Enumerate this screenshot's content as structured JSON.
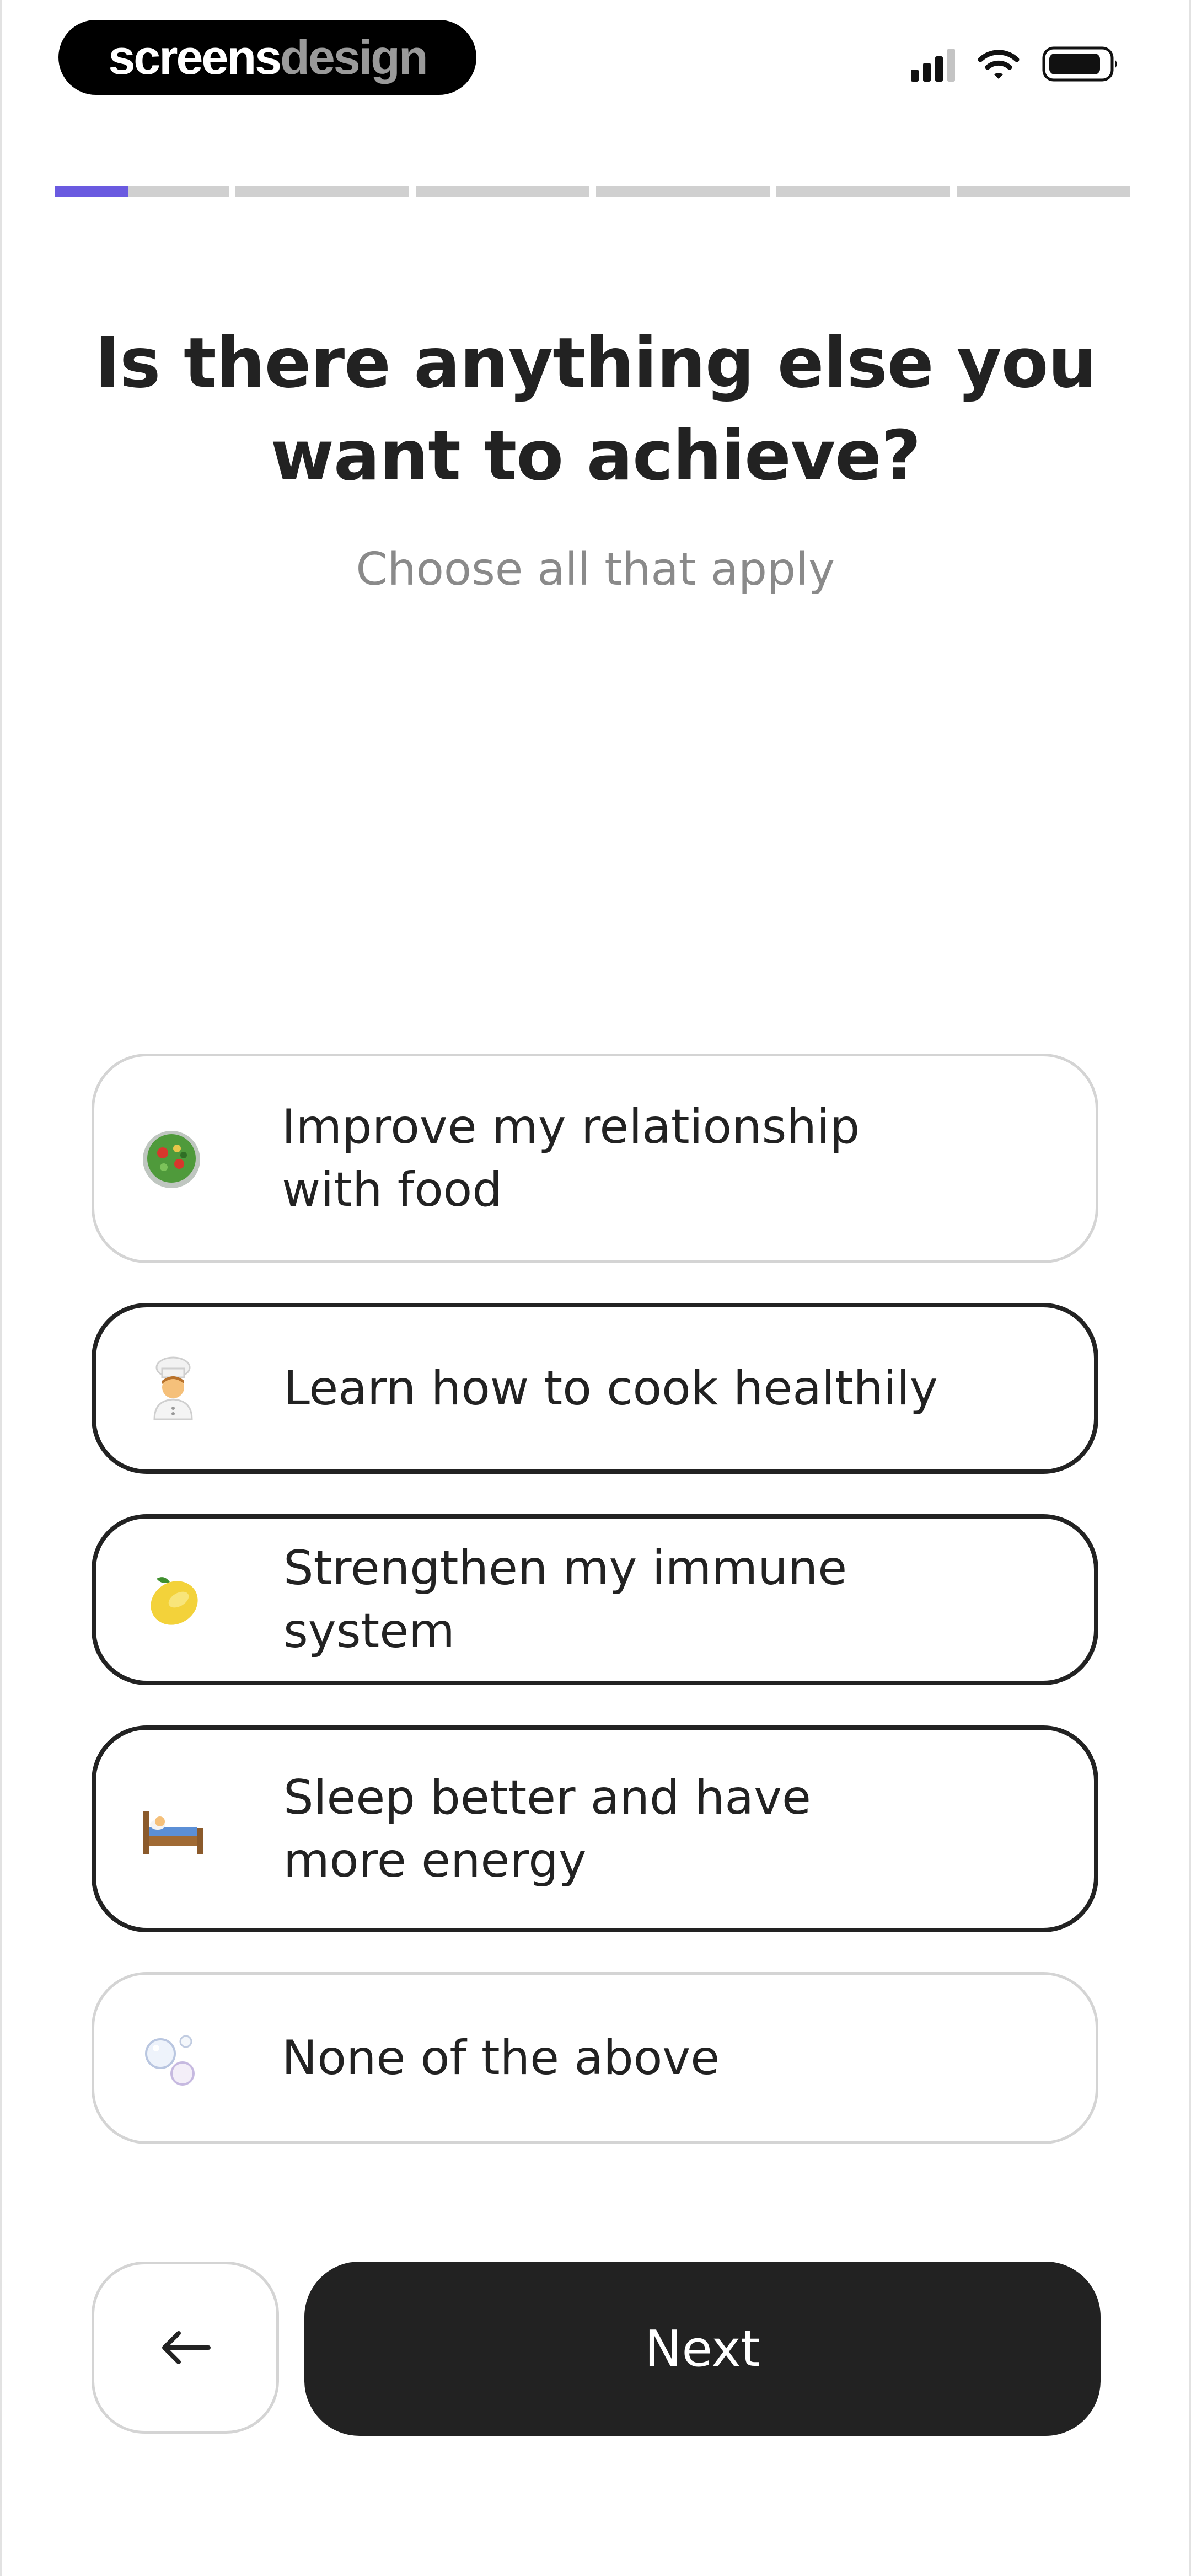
{
  "watermark": {
    "word1": "screens",
    "word2": "design"
  },
  "status_bar": {
    "icons": [
      "signal-icon",
      "wifi-icon",
      "battery-icon"
    ]
  },
  "progress": {
    "segments": 6,
    "current_step_fraction": 0.42
  },
  "question": {
    "title_line1": "Is there anything else you",
    "title_line2": "want to achieve?",
    "subtitle": "Choose all that apply"
  },
  "options": [
    {
      "line1": "Improve my relationship",
      "line2": "with food",
      "icon": "salad-icon",
      "selected": false
    },
    {
      "line1": "Learn how to cook healthily",
      "line2": "",
      "icon": "cook-icon",
      "selected": true
    },
    {
      "line1": "Strengthen my immune system",
      "line2": "",
      "icon": "lemon-icon",
      "selected": true
    },
    {
      "line1": "Sleep better and have",
      "line2": "more energy",
      "icon": "bed-icon",
      "selected": true
    },
    {
      "line1": "None of the above",
      "line2": "",
      "icon": "bubbles-icon",
      "selected": false
    }
  ],
  "nav": {
    "back_icon": "arrow-left-icon",
    "next_label": "Next"
  },
  "colors": {
    "accent": "#6a5ae0",
    "dark": "#222222",
    "border_light": "#d4d4d4",
    "subtitle": "#8a8a8a"
  }
}
